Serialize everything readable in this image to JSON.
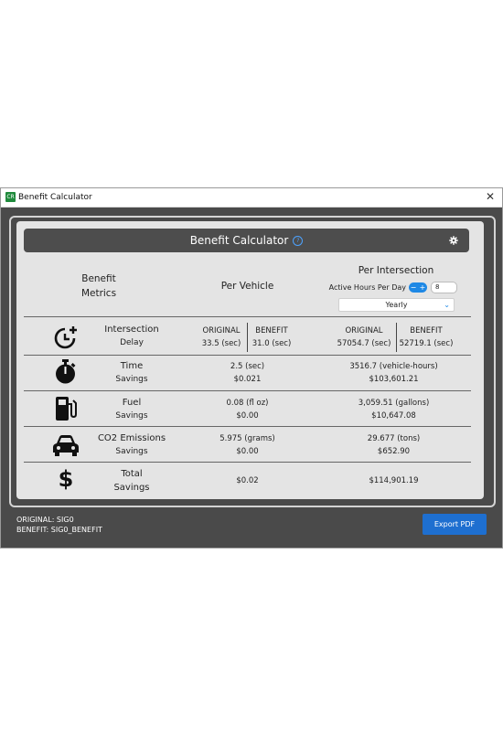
{
  "window": {
    "title": "Benefit Calculator",
    "app_icon_text": "CR",
    "close_symbol": "✕"
  },
  "panel": {
    "header_title": "Benefit Calculator",
    "help_symbol": "?",
    "columns": {
      "metrics_line1": "Benefit",
      "metrics_line2": "Metrics",
      "per_vehicle": "Per Vehicle",
      "per_intersection": "Per Intersection",
      "active_hours_label": "Active Hours Per Day",
      "active_hours_value": "8",
      "period_selected": "Yearly"
    },
    "rows": {
      "delay": {
        "icon": "clock-plus-icon",
        "line1": "Intersection",
        "line2": "Delay",
        "veh_original_label": "ORIGINAL",
        "veh_original_value": "33.5 (sec)",
        "veh_benefit_label": "BENEFIT",
        "veh_benefit_value": "31.0 (sec)",
        "int_original_label": "ORIGINAL",
        "int_original_value": "57054.7 (sec)",
        "int_benefit_label": "BENEFIT",
        "int_benefit_value": "52719.1 (sec)"
      },
      "time": {
        "icon": "stopwatch-icon",
        "line1": "Time",
        "line2": "Savings",
        "veh_line1": "2.5 (sec)",
        "veh_line2": "$0.021",
        "int_line1": "3516.7 (vehicle-hours)",
        "int_line2": "$103,601.21"
      },
      "fuel": {
        "icon": "fuel-pump-icon",
        "line1": "Fuel",
        "line2": "Savings",
        "veh_line1": "0.08 (fl oz)",
        "veh_line2": "$0.00",
        "int_line1": "3,059.51 (gallons)",
        "int_line2": "$10,647.08"
      },
      "co2": {
        "icon": "car-icon",
        "line1": "CO2 Emissions",
        "line2": "Savings",
        "veh_line1": "5.975 (grams)",
        "veh_line2": "$0.00",
        "int_line1": "29.677 (tons)",
        "int_line2": "$652.90"
      },
      "total": {
        "icon": "dollar-icon",
        "line1": "Total",
        "line2": "Savings",
        "veh_value": "$0.02",
        "int_value": "$114,901.19"
      }
    }
  },
  "footer": {
    "original": "ORIGINAL: SIG0",
    "benefit": "BENEFIT: SIG0_BENEFIT",
    "export_label": "Export PDF"
  },
  "colors": {
    "accent": "#1e6fd0",
    "window_bg": "#4a4a4a",
    "panel_bg": "#e4e4e4",
    "header_bg": "#4d4d4d"
  }
}
